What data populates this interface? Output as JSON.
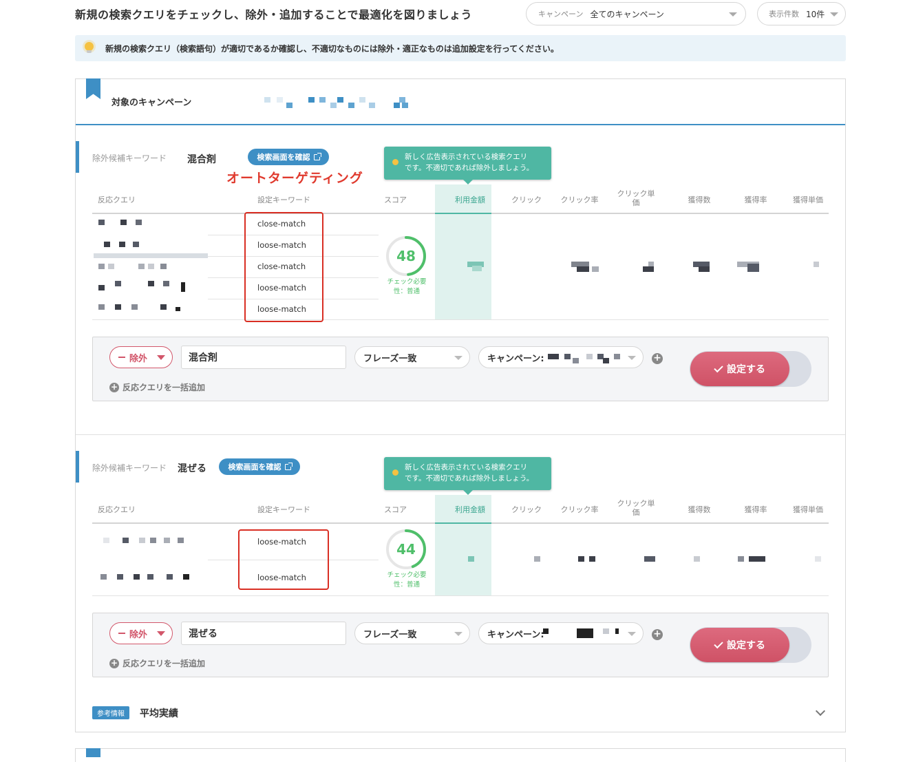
{
  "header": {
    "title": "新規の検索クエリをチェックし、除外・追加することで最適化を図りましょう",
    "campaign_filter": {
      "label": "キャンペーン",
      "value": "全てのキャンペーン"
    },
    "count_filter": {
      "label": "表示件数",
      "value": "10件"
    }
  },
  "banner": {
    "text": "新規の検索クエリ（検索語句）が適切であるか確認し、不適切なものには除外・適正なものは追加設定を行ってください。"
  },
  "campaign_block": {
    "label": "対象のキャンペーン"
  },
  "annotation": "オートターゲティング",
  "columns": [
    "反応クエリ",
    "設定キーワード",
    "スコア",
    "利用金額",
    "クリック",
    "クリック率",
    "クリック単価",
    "獲得数",
    "獲得率",
    "獲得単価"
  ],
  "tooltip": {
    "line1": "新しく広告表示されている検索クエリ",
    "line2": "です。不適切であれば除外しましょう。"
  },
  "sections": [
    {
      "candidate_label": "除外候補キーワード",
      "keyword": "混合剤",
      "check_button": "検索画面を確認",
      "match_types": [
        "close-match",
        "loose-match",
        "close-match",
        "loose-match",
        "loose-match"
      ],
      "score": 48,
      "score_max": 100,
      "score_note_line1": "チェック必要",
      "score_note_line2": "性：普通",
      "action": {
        "exclude_label": "除外",
        "keyword_value": "混合剤",
        "match_select": "フレーズ一致",
        "campaign_select": "キャンペーン:",
        "submit_label": "設定する",
        "bulk_add_label": "反応クエリを一括追加"
      }
    },
    {
      "candidate_label": "除外候補キーワード",
      "keyword": "混ぜる",
      "check_button": "検索画面を確認",
      "match_types": [
        "loose-match",
        "loose-match"
      ],
      "score": 44,
      "score_max": 100,
      "score_note_line1": "チェック必要",
      "score_note_line2": "性：普通",
      "action": {
        "exclude_label": "除外",
        "keyword_value": "混ぜる",
        "match_select": "フレーズ一致",
        "campaign_select": "キャンペーン:",
        "submit_label": "設定する",
        "bulk_add_label": "反応クエリを一括追加"
      }
    }
  ],
  "reference": {
    "badge": "参考情報",
    "title": "平均実績"
  },
  "colors": {
    "accent_blue": "#3e8fc5",
    "teal": "#4fb7a3",
    "score_green": "#4fbf6a",
    "exclude_red": "#d2566a",
    "annotation_red": "#e03a2e"
  }
}
